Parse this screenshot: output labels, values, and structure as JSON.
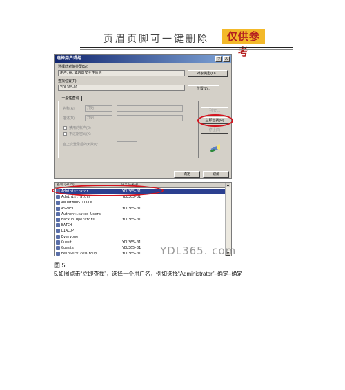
{
  "header": {
    "text": "页眉页脚可一键删除",
    "badge": "仅供参考"
  },
  "dialog": {
    "title": "选择用户或组",
    "help_button": "?",
    "close_button": "X",
    "object_type_label": "选择此对象类型(S):",
    "object_type_value": "用户, 组, 或内置安全性原则",
    "object_type_button": "对象类型(O)...",
    "location_label": "查找位置(F):",
    "location_value": "YDL365-01",
    "location_button": "位置(L)...",
    "tab_label": "一般性查询",
    "name_label": "名称(A):",
    "desc_label": "描述(D):",
    "name_mode": "开始",
    "desc_mode": "开始",
    "disabled_accounts": "禁用的帐户(B)",
    "nonexpiring_password": "不过期密码(X)",
    "days_since_logon": "自上次登录后的天数(I):",
    "columns_button": "列(C)...",
    "find_now_button": "立即查找(N)",
    "stop_button": "停止(T)",
    "ok_button": "确定",
    "cancel_button": "取消"
  },
  "results": {
    "columns": [
      "名称 (RDN)",
      "在文件夹中"
    ],
    "rows": [
      {
        "name": "Administrator",
        "folder": "YDL365-01",
        "selected": true
      },
      {
        "name": "Administrators",
        "folder": "YDL365-01",
        "selected": false
      },
      {
        "name": "ANONYMOUS LOGON",
        "folder": "",
        "selected": false
      },
      {
        "name": "ASPNET",
        "folder": "YDL365-01",
        "selected": false
      },
      {
        "name": "Authenticated Users",
        "folder": "",
        "selected": false
      },
      {
        "name": "Backup Operators",
        "folder": "YDL365-01",
        "selected": false
      },
      {
        "name": "BATCH",
        "folder": "",
        "selected": false
      },
      {
        "name": "DIALUP",
        "folder": "",
        "selected": false
      },
      {
        "name": "Everyone",
        "folder": "",
        "selected": false
      },
      {
        "name": "Guest",
        "folder": "YDL365-01",
        "selected": false
      },
      {
        "name": "Guests",
        "folder": "YDL365-01",
        "selected": false
      },
      {
        "name": "HelpServicesGroup",
        "folder": "YDL365-01",
        "selected": false
      }
    ],
    "watermark": "YDL365. com"
  },
  "caption": "图 5",
  "instruction": "5.如图点击“立即查找”，选择一个用户名，例如选择“Administrator”–确定–确定",
  "colors": {
    "highlight": "#d3131e",
    "badge_bg": "#f3b92a",
    "titlebar": "#11256e"
  }
}
